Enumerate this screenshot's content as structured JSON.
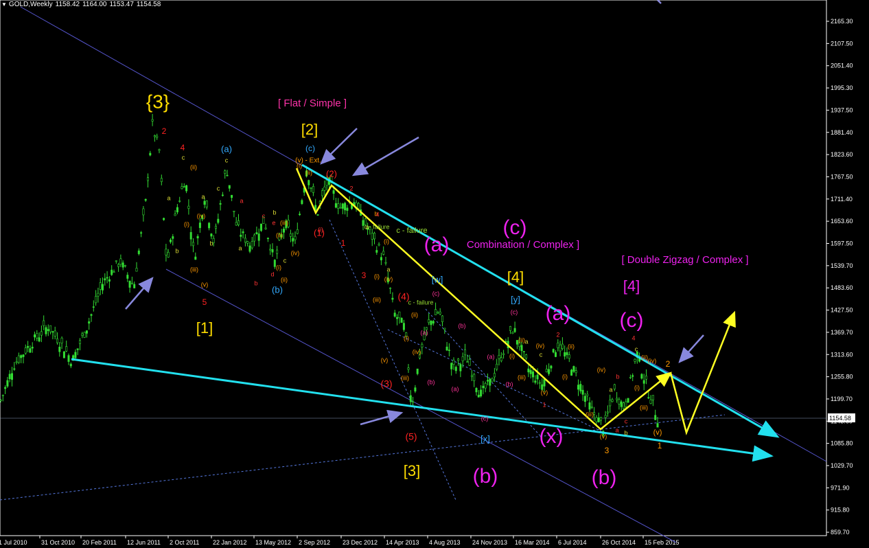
{
  "header": {
    "symbol": "GOLD,Weekly",
    "open": "1158.42",
    "high": "1164.00",
    "low": "1153.47",
    "close": "1154.58"
  },
  "colors": {
    "background": "#000000",
    "candle": "#33dd33",
    "axis": "#ffffff",
    "trend_cyan": "#22e0ee",
    "channel": "#5555cc",
    "path_yellow": "#ffff22",
    "arrow_purple": "#8888dd",
    "wave_yellow": "#ffdd00",
    "wave_magenta": "#ee22ee",
    "wave_pink": "#ff33aa",
    "wave_red": "#ff2222",
    "wave_orange": "#ff9900",
    "wave_cyan": "#33aaff",
    "wave_green": "#99dd33"
  },
  "chart_data": {
    "type": "candlestick",
    "title": "GOLD,Weekly",
    "ylim": [
      859.7,
      2200
    ],
    "y_ticks": [
      "2165.30",
      "2107.50",
      "2051.40",
      "1995.30",
      "1937.50",
      "1881.40",
      "1823.60",
      "1767.50",
      "1711.40",
      "1653.60",
      "1597.50",
      "1539.70",
      "1483.60",
      "1427.50",
      "1369.70",
      "1313.60",
      "1255.80",
      "1199.70",
      "1143.60",
      "1085.80",
      "1029.70",
      "971.90",
      "915.80",
      "859.70"
    ],
    "x_ticks": [
      "1 Jul 2010",
      "31 Oct 2010",
      "20 Feb 2011",
      "12 Jun 2011",
      "2 Oct 2011",
      "22 Jan 2012",
      "13 May 2012",
      "2 Sep 2012",
      "23 Dec 2012",
      "14 Apr 2013",
      "4 Aug 2013",
      "24 Nov 2013",
      "16 Mar 2014",
      "6 Jul 2014",
      "26 Oct 2014",
      "15 Feb 2015"
    ],
    "current_price": "1154.58",
    "price_path": [
      [
        0,
        1195
      ],
      [
        20,
        1290
      ],
      [
        45,
        1345
      ],
      [
        70,
        1390
      ],
      [
        95,
        1330
      ],
      [
        105,
        1300
      ],
      [
        125,
        1380
      ],
      [
        150,
        1500
      ],
      [
        175,
        1555
      ],
      [
        195,
        1490
      ],
      [
        212,
        1700
      ],
      [
        222,
        1900
      ],
      [
        232,
        1835
      ],
      [
        243,
        1545
      ],
      [
        258,
        1690
      ],
      [
        270,
        1770
      ],
      [
        283,
        1560
      ],
      [
        298,
        1720
      ],
      [
        312,
        1600
      ],
      [
        330,
        1795
      ],
      [
        345,
        1640
      ],
      [
        365,
        1595
      ],
      [
        385,
        1660
      ],
      [
        400,
        1550
      ],
      [
        415,
        1650
      ],
      [
        430,
        1600
      ],
      [
        447,
        1795
      ],
      [
        462,
        1675
      ],
      [
        478,
        1760
      ],
      [
        495,
        1690
      ],
      [
        515,
        1710
      ],
      [
        535,
        1640
      ],
      [
        560,
        1560
      ],
      [
        575,
        1420
      ],
      [
        590,
        1385
      ],
      [
        600,
        1185
      ],
      [
        612,
        1320
      ],
      [
        625,
        1395
      ],
      [
        640,
        1430
      ],
      [
        660,
        1280
      ],
      [
        680,
        1310
      ],
      [
        700,
        1215
      ],
      [
        716,
        1250
      ],
      [
        732,
        1320
      ],
      [
        748,
        1385
      ],
      [
        770,
        1280
      ],
      [
        790,
        1240
      ],
      [
        812,
        1345
      ],
      [
        830,
        1300
      ],
      [
        845,
        1240
      ],
      [
        862,
        1175
      ],
      [
        880,
        1130
      ],
      [
        895,
        1225
      ],
      [
        910,
        1180
      ],
      [
        928,
        1320
      ],
      [
        945,
        1220
      ],
      [
        958,
        1155
      ]
    ],
    "lines": [
      {
        "name": "channel-upper",
        "kind": "channel"
      },
      {
        "name": "channel-lower",
        "kind": "channel"
      },
      {
        "name": "support-dotted",
        "kind": "dotted"
      },
      {
        "name": "trend-cyan-upper",
        "kind": "cyan-arrow"
      },
      {
        "name": "trend-cyan-lower",
        "kind": "cyan-arrow"
      },
      {
        "name": "projection-yellow",
        "kind": "yellow-path"
      }
    ],
    "wave_labels": [
      {
        "text": "{3}",
        "color": "wave_yellow",
        "size": 28
      },
      {
        "text": "[ Flat / Simple ]",
        "color": "wave_pink",
        "size": 15
      },
      {
        "text": "[2]",
        "color": "wave_yellow",
        "size": 22
      },
      {
        "text": "(c)",
        "color": "wave_cyan",
        "size": 12
      },
      {
        "text": "(v) - Ext.",
        "color": "wave_orange",
        "size": 10
      },
      {
        "text": "(2)",
        "color": "wave_red",
        "size": 13
      },
      {
        "text": "(1)",
        "color": "wave_red",
        "size": 13
      },
      {
        "text": "2",
        "color": "wave_red",
        "size": 12
      },
      {
        "text": "4",
        "color": "wave_red",
        "size": 12
      },
      {
        "text": "1",
        "color": "wave_red",
        "size": 12
      },
      {
        "text": "3",
        "color": "wave_red",
        "size": 12
      },
      {
        "text": "5",
        "color": "wave_red",
        "size": 12
      },
      {
        "text": "(a)",
        "color": "wave_cyan",
        "size": 13
      },
      {
        "text": "(b)",
        "color": "wave_cyan",
        "size": 13
      },
      {
        "text": "[1]",
        "color": "wave_yellow",
        "size": 22
      },
      {
        "text": "(a)",
        "color": "wave_magenta",
        "size": 30
      },
      {
        "text": "(c)",
        "color": "wave_magenta",
        "size": 30
      },
      {
        "text": "Combination / Complex ]",
        "color": "wave_magenta",
        "size": 15
      },
      {
        "text": "c - failure",
        "color": "wave_green",
        "size": 11
      },
      {
        "text": "(4)",
        "color": "wave_red",
        "size": 14
      },
      {
        "text": "(3)",
        "color": "wave_red",
        "size": 14
      },
      {
        "text": "(5)",
        "color": "wave_red",
        "size": 14
      },
      {
        "text": "[3]",
        "color": "wave_yellow",
        "size": 22
      },
      {
        "text": "[w]",
        "color": "wave_cyan",
        "size": 13
      },
      {
        "text": "[4]",
        "color": "wave_yellow",
        "size": 22
      },
      {
        "text": "[y]",
        "color": "wave_cyan",
        "size": 13
      },
      {
        "text": "[x]",
        "color": "wave_cyan",
        "size": 13
      },
      {
        "text": "(b)",
        "color": "wave_magenta",
        "size": 30
      },
      {
        "text": "(x)",
        "color": "wave_magenta",
        "size": 30
      },
      {
        "text": "(a)",
        "color": "wave_magenta",
        "size": 30
      },
      {
        "text": "[ Double Zigzag / Complex ]",
        "color": "wave_magenta",
        "size": 15
      },
      {
        "text": "[4]",
        "color": "wave_magenta",
        "size": 22
      },
      {
        "text": "(c)",
        "color": "wave_magenta",
        "size": 30
      },
      {
        "text": "(b)",
        "color": "wave_magenta",
        "size": 30
      },
      {
        "text": "2",
        "color": "wave_orange",
        "size": 12
      },
      {
        "text": "1",
        "color": "wave_orange",
        "size": 12
      },
      {
        "text": "3",
        "color": "wave_orange",
        "size": 12
      },
      {
        "text": "(v)",
        "color": "wave_orange",
        "size": 11
      }
    ]
  }
}
